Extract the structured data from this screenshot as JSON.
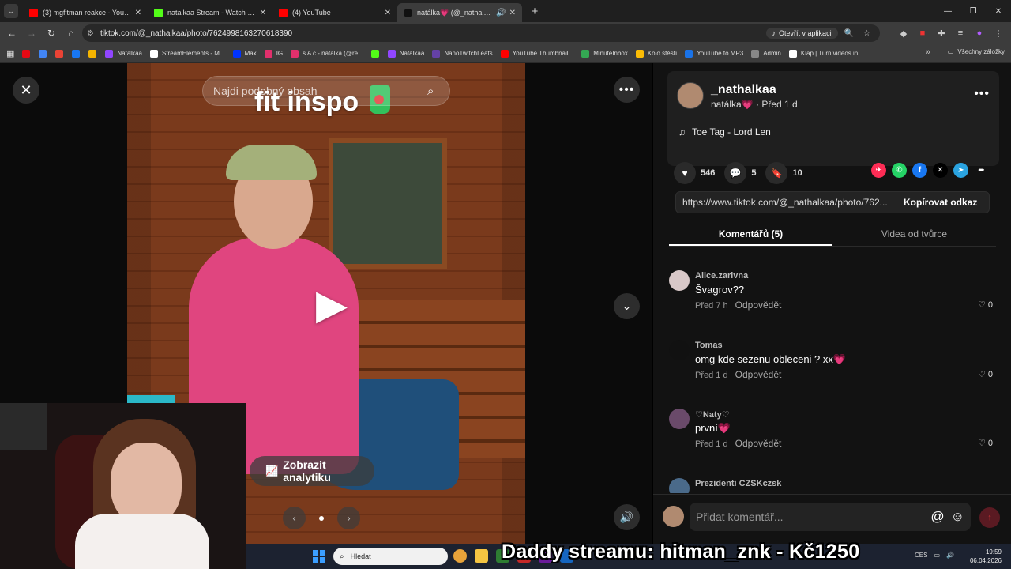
{
  "browser": {
    "tabs": [
      {
        "title": "(3) mgfitman reakce - YouTube",
        "color": "#ff0000",
        "active": false
      },
      {
        "title": "natalkaa Stream - Watch Live on",
        "color": "#53fc18",
        "active": false
      },
      {
        "title": "(4) YouTube",
        "color": "#ff0000",
        "active": false
      },
      {
        "title": "natálka💗 (@_nathalkaa) | ",
        "color": "#111111",
        "active": true
      }
    ],
    "url": "tiktok.com/@_nathalkaa/photo/7624998163270618390",
    "open_in_app": "Otevřít v aplikaci",
    "bookmarks": [
      {
        "label": "",
        "color": "#e50914"
      },
      {
        "label": "",
        "color": "#4285f4"
      },
      {
        "label": "",
        "color": "#ea4335"
      },
      {
        "label": "",
        "color": "#1877f2"
      },
      {
        "label": "",
        "color": "#f4b400"
      },
      {
        "label": "Natalkaa",
        "color": "#9146ff"
      },
      {
        "label": "StreamElements - M...",
        "color": "#ffffff"
      },
      {
        "label": "Max",
        "color": "#0033ff"
      },
      {
        "label": "IG",
        "color": "#e1306c"
      },
      {
        "label": "s A c - natalka (@re...",
        "color": "#e1306c"
      },
      {
        "label": "",
        "color": "#53fc18"
      },
      {
        "label": "Natalkaa",
        "color": "#9146ff"
      },
      {
        "label": "NanoTwitchLeafs",
        "color": "#6441a5"
      },
      {
        "label": "YouTube Thumbnail...",
        "color": "#ff0000"
      },
      {
        "label": "MinuteInbox",
        "color": "#34a853"
      },
      {
        "label": "Kolo štěstí",
        "color": "#fbbc05"
      },
      {
        "label": "YouTube to MP3",
        "color": "#1a73e8"
      },
      {
        "label": "Admin",
        "color": "#888888"
      },
      {
        "label": "Klap | Turn videos in...",
        "color": "#ffffff"
      }
    ],
    "all_bookmarks": "Všechny záložky"
  },
  "viewer": {
    "search_placeholder": "Najdi podobný obsah",
    "photo_title": "fit inspo",
    "analytics_label": "Zobrazit analytiku"
  },
  "panel": {
    "author_name": "_nathalkaa",
    "author_display": "natálka💗",
    "author_time": "· Před 1 d",
    "music": "Toe Tag - Lord Len",
    "likes": "546",
    "comments_count": "5",
    "saves": "10",
    "share_link": "https://www.tiktok.com/@_nathalkaa/photo/762...",
    "copy_label": "Kopírovat odkaz",
    "tab_comments": "Komentářů (5)",
    "tab_creator": "Videa od tvůrce",
    "comments": [
      {
        "user": "Alice.zarivna",
        "text": "Švagrov??",
        "time": "Před 7 h",
        "reply": "Odpovědět",
        "likes": "0",
        "avatar": "#d8c8c8"
      },
      {
        "user": "Tomas",
        "text": "omg kde sezenu obleceni ? xx💗",
        "time": "Před 1 d",
        "reply": "Odpovědět",
        "likes": "0",
        "avatar": "#111111"
      },
      {
        "user": "♡Naty♡",
        "text": "první💗",
        "time": "Před 1 d",
        "reply": "Odpovědět",
        "likes": "0",
        "avatar": "#6a4a6a"
      },
      {
        "user": "Prezidenti CZSKczsk",
        "text": "",
        "time": "",
        "reply": "",
        "likes": "",
        "avatar": "#4a6a8a"
      }
    ],
    "comment_placeholder": "Přidat komentář..."
  },
  "taskbar": {
    "search": "Hledat",
    "lang": "CES",
    "time": "19:59",
    "date": "06.04.2026"
  },
  "ticker": "Daddy streamu: hitman_znk - Kč1250"
}
